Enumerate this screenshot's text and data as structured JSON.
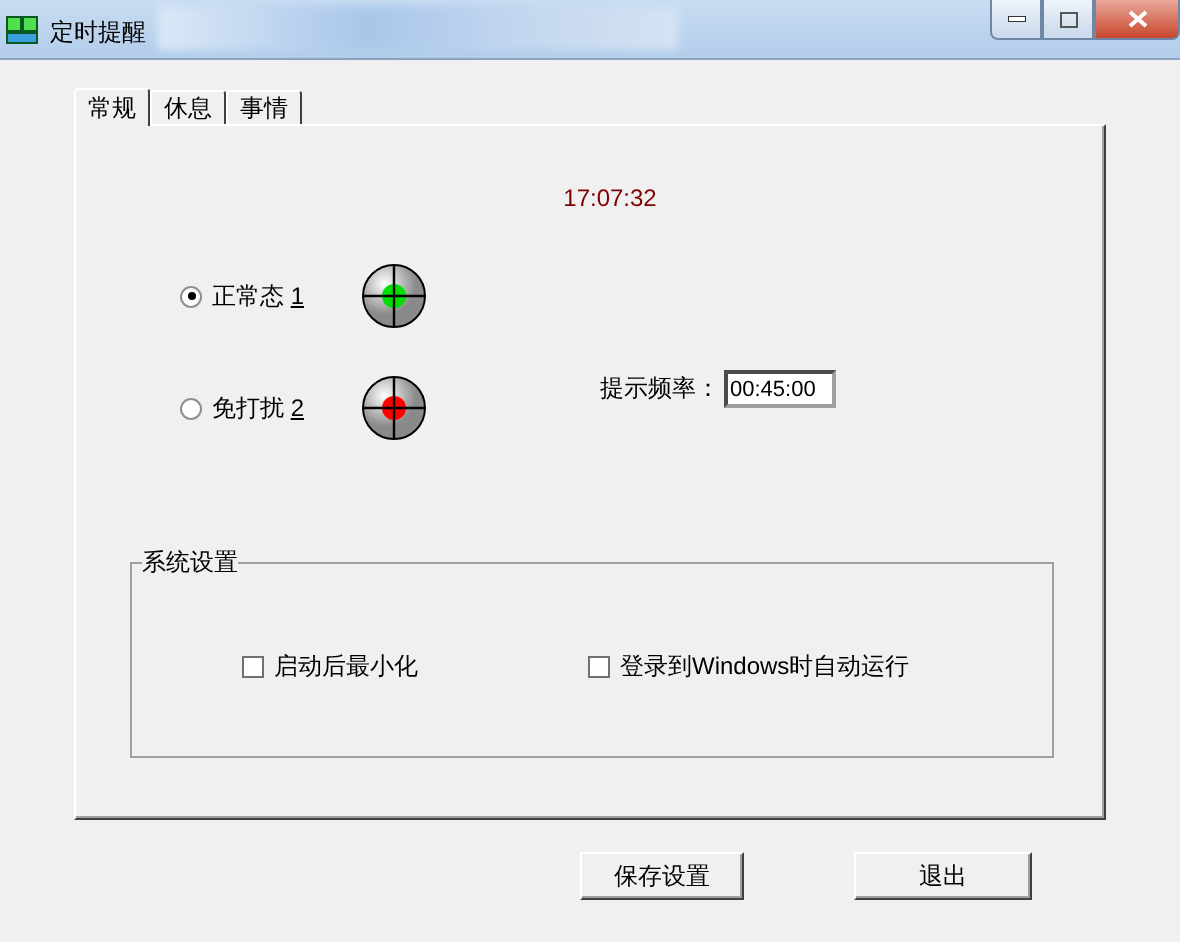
{
  "window": {
    "title": "定时提醒"
  },
  "tabs": [
    {
      "label": "常规",
      "selected": true
    },
    {
      "label": "休息",
      "selected": false
    },
    {
      "label": "事情",
      "selected": false
    }
  ],
  "clock": "17:07:32",
  "modes": [
    {
      "label": "正常态",
      "hotkey": "1",
      "selected": true,
      "color": "#00e000"
    },
    {
      "label": "免打扰",
      "hotkey": "2",
      "selected": false,
      "color": "#ff0000"
    }
  ],
  "interval": {
    "label": "提示频率：",
    "value": "00:45:00"
  },
  "system_settings": {
    "title": "系统设置",
    "options": [
      {
        "label": "启动后最小化",
        "checked": false
      },
      {
        "label": "登录到Windows时自动运行",
        "checked": false
      }
    ]
  },
  "buttons": [
    "保存设置",
    "退出"
  ]
}
